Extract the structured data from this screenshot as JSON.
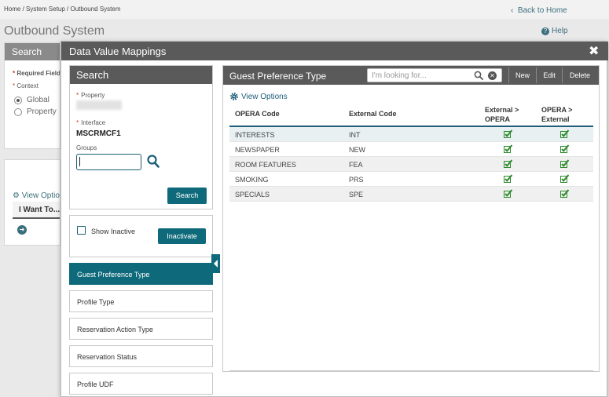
{
  "breadcrumb": "Home / System Setup / Outbound System",
  "back_home": "Back to Home",
  "page_title": "Outbound System",
  "help": "Help",
  "bg_search_panel": {
    "title": "Search",
    "required_label": "Required Fields",
    "context_label": "Context",
    "radio_global": "Global",
    "radio_property": "Property",
    "view_options": "View Options",
    "i_want_to": "I Want To..."
  },
  "modal": {
    "title": "Data Value Mappings",
    "close": "✖"
  },
  "search_card": {
    "title": "Search",
    "property_label": "Property",
    "interface_label": "Interface",
    "interface_value": "MSCRMCF1",
    "groups_label": "Groups",
    "groups_value": "",
    "search_button": "Search"
  },
  "inactive_card": {
    "show_inactive_label": "Show Inactive",
    "inactivate_button": "Inactivate"
  },
  "menu_items": [
    {
      "label": "Guest Preference Type",
      "active": true
    },
    {
      "label": "Profile Type",
      "active": false
    },
    {
      "label": "Reservation Action Type",
      "active": false
    },
    {
      "label": "Reservation Status",
      "active": false
    },
    {
      "label": "Profile UDF",
      "active": false
    }
  ],
  "right_panel": {
    "title": "Guest Preference Type",
    "search_placeholder": "I'm looking for...",
    "btn_new": "New",
    "btn_edit": "Edit",
    "btn_delete": "Delete",
    "view_options": "View Options",
    "columns": {
      "opera_code": "OPERA Code",
      "external_code": "External Code",
      "ext_to_opera_1": "External >",
      "ext_to_opera_2": "OPERA",
      "opera_to_ext_1": "OPERA >",
      "opera_to_ext_2": "External"
    },
    "rows": [
      {
        "opera": "INTERESTS",
        "external": "INT",
        "ext_to_opera": true,
        "opera_to_ext": true
      },
      {
        "opera": "NEWSPAPER",
        "external": "NEW",
        "ext_to_opera": true,
        "opera_to_ext": true
      },
      {
        "opera": "ROOM FEATURES",
        "external": "FEA",
        "ext_to_opera": true,
        "opera_to_ext": true
      },
      {
        "opera": "SMOKING",
        "external": "PRS",
        "ext_to_opera": true,
        "opera_to_ext": true
      },
      {
        "opera": "SPECIALS",
        "external": "SPE",
        "ext_to_opera": true,
        "opera_to_ext": true
      }
    ]
  },
  "colors": {
    "accent": "#0e6a7a",
    "header_gray": "#5a5a5a",
    "check_green": "#2e8b2e"
  }
}
